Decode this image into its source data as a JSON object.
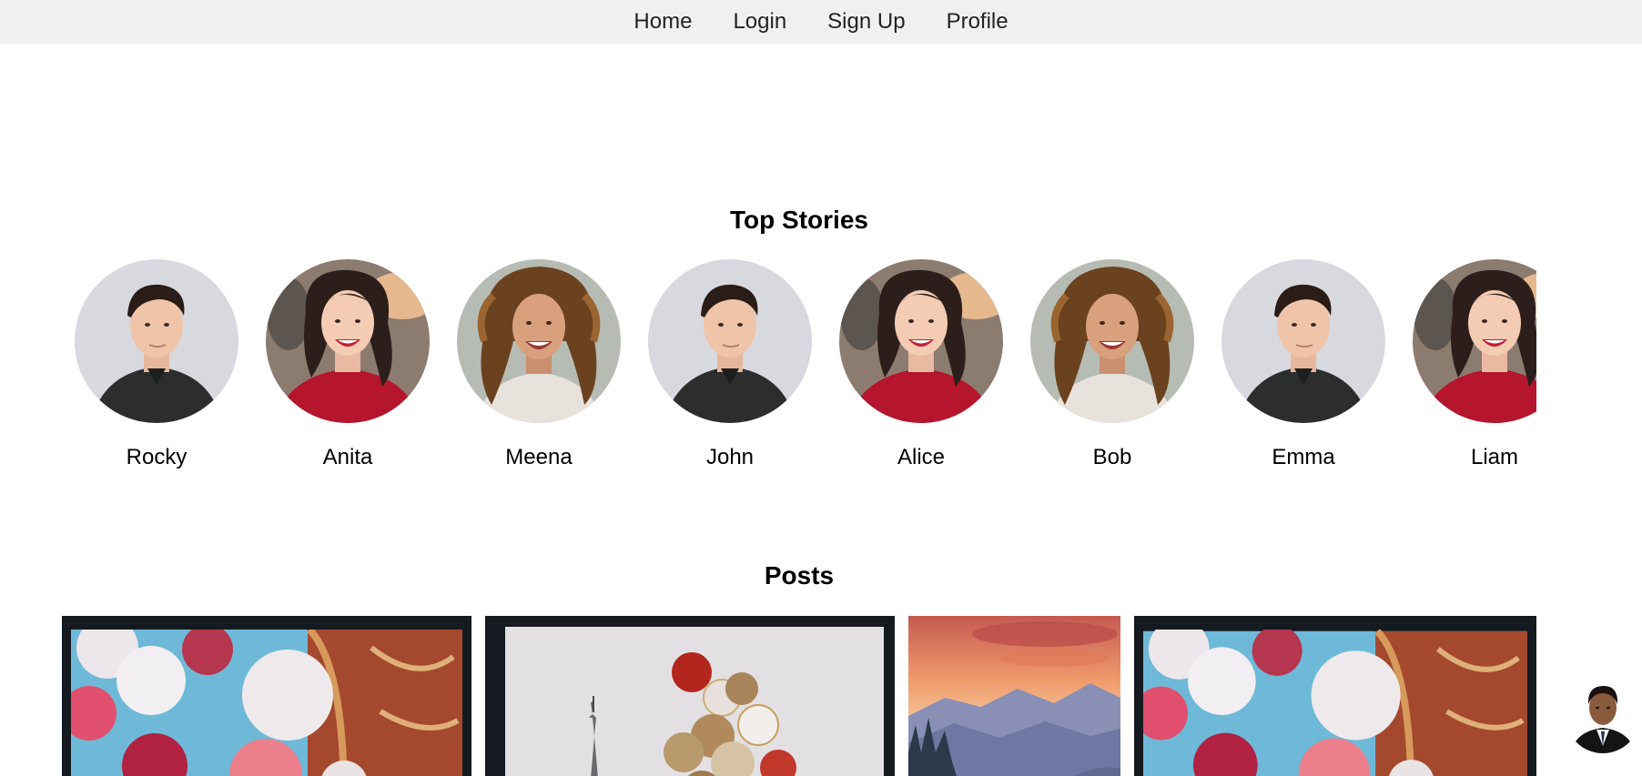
{
  "nav": {
    "links": [
      "Home",
      "Login",
      "Sign Up",
      "Profile"
    ]
  },
  "stories": {
    "title": "Top Stories",
    "items": [
      {
        "name": "Rocky",
        "avatar": "man-portrait"
      },
      {
        "name": "Anita",
        "avatar": "woman-red-sweater"
      },
      {
        "name": "Meena",
        "avatar": "woman-curly-hair"
      },
      {
        "name": "John",
        "avatar": "man-portrait"
      },
      {
        "name": "Alice",
        "avatar": "woman-red-sweater"
      },
      {
        "name": "Bob",
        "avatar": "woman-curly-hair"
      },
      {
        "name": "Emma",
        "avatar": "man-portrait"
      },
      {
        "name": "Liam",
        "avatar": "woman-red-sweater"
      }
    ]
  },
  "posts": {
    "title": "Posts",
    "items": [
      {
        "image": "balloons-carousel"
      },
      {
        "image": "balloons-eiffel-tower"
      },
      {
        "image": "mountain-sunset"
      },
      {
        "image": "balloons-carousel"
      }
    ]
  },
  "floating_profile": {
    "image": "man-in-suit"
  }
}
